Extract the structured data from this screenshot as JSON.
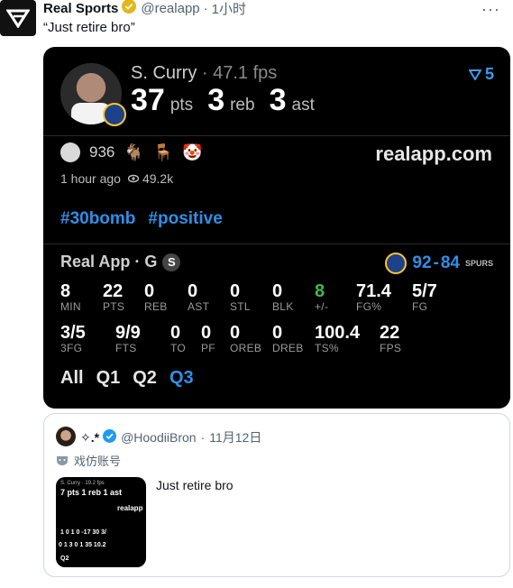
{
  "tweet": {
    "author_name": "Real Sports",
    "handle": "@realapp",
    "separator": "·",
    "time": "1小时",
    "more_label": "···",
    "text": "“Just retire bro”"
  },
  "card": {
    "player_name": "S. Curry",
    "fps_text": "47.1 fps",
    "pts_value": "37",
    "pts_label": "pts",
    "reb_value": "3",
    "reb_label": "reb",
    "ast_value": "3",
    "ast_label": "ast",
    "filter_count": "5",
    "reaction_count": "936",
    "site": "realapp.com",
    "posted_ago": "1 hour ago",
    "views": "49.2k",
    "hashtags": [
      "#30bomb",
      "#positive"
    ],
    "game_title": "Real App · G",
    "game_badge": "S",
    "score_home": "92",
    "score_sep": "-",
    "score_away": "84",
    "spurs_wordmark": "SPURS",
    "stats_row1": [
      {
        "v": "8",
        "l": "MIN"
      },
      {
        "v": "22",
        "l": "PTS"
      },
      {
        "v": "0",
        "l": "REB"
      },
      {
        "v": "0",
        "l": "AST"
      },
      {
        "v": "0",
        "l": "STL"
      },
      {
        "v": "0",
        "l": "BLK"
      },
      {
        "v": "8",
        "l": "+/-",
        "color": "#3fb950"
      },
      {
        "v": "71.4",
        "l": "FG%"
      },
      {
        "v": "5/7",
        "l": "FG"
      }
    ],
    "stats_row2": [
      {
        "v": "3/5",
        "l": "3FG"
      },
      {
        "v": "9/9",
        "l": "FTS"
      },
      {
        "v": "0",
        "l": "TO"
      },
      {
        "v": "0",
        "l": "PF"
      },
      {
        "v": "0",
        "l": "OREB"
      },
      {
        "v": "0",
        "l": "DREB"
      },
      {
        "v": "100.4",
        "l": "TS%"
      },
      {
        "v": "22",
        "l": "FPS"
      }
    ],
    "quarters": [
      "All",
      "Q1",
      "Q2",
      "Q3"
    ],
    "active_quarter": "Q3"
  },
  "quote": {
    "author_name": "✧.*",
    "handle": "@HoodiiBron",
    "separator": "·",
    "date": "11月12日",
    "parody_label": "戏仿账号",
    "text": "Just retire bro",
    "thumb": {
      "name": "S. Curry · 19.2 fps",
      "line": "7 pts 1 reb 1 ast",
      "site": "realapp",
      "row1": "1   0   1   0  -17  30   3/",
      "row2": "0   1   3   0   1   35  10.2",
      "q": "Q2"
    }
  },
  "colors": {
    "accent_blue": "#1d9bf0",
    "card_bg": "#000000",
    "hashtag_blue": "#2f8fe8",
    "plus_minus_green": "#3fb950",
    "verified_gold": "#e2b719"
  }
}
